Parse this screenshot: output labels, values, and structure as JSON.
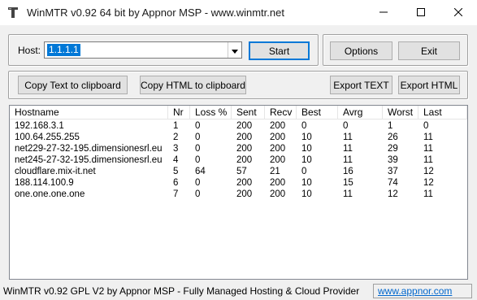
{
  "window": {
    "title": "WinMTR v0.92 64 bit by Appnor MSP - www.winmtr.net"
  },
  "host": {
    "label": "Host:",
    "value": "1.1.1.1"
  },
  "buttons": {
    "start": "Start",
    "options": "Options",
    "exit": "Exit",
    "copy_text": "Copy Text to clipboard",
    "copy_html": "Copy HTML to clipboard",
    "export_text": "Export TEXT",
    "export_html": "Export HTML"
  },
  "table": {
    "columns": [
      "Hostname",
      "Nr",
      "Loss %",
      "Sent",
      "Recv",
      "Best",
      "Avrg",
      "Worst",
      "Last"
    ],
    "rows": [
      [
        "192.168.3.1",
        "1",
        "0",
        "200",
        "200",
        "0",
        "0",
        "1",
        "0"
      ],
      [
        "100.64.255.255",
        "2",
        "0",
        "200",
        "200",
        "10",
        "11",
        "26",
        "11"
      ],
      [
        "net229-27-32-195.dimensionesrl.eu",
        "3",
        "0",
        "200",
        "200",
        "10",
        "11",
        "29",
        "11"
      ],
      [
        "net245-27-32-195.dimensionesrl.eu",
        "4",
        "0",
        "200",
        "200",
        "10",
        "11",
        "39",
        "11"
      ],
      [
        "cloudflare.mix-it.net",
        "5",
        "64",
        "57",
        "21",
        "0",
        "16",
        "37",
        "12"
      ],
      [
        "188.114.100.9",
        "6",
        "0",
        "200",
        "200",
        "10",
        "15",
        "74",
        "12"
      ],
      [
        "one.one.one.one",
        "7",
        "0",
        "200",
        "200",
        "10",
        "11",
        "12",
        "11"
      ]
    ]
  },
  "statusbar": {
    "text": "WinMTR v0.92 GPL V2 by Appnor MSP - Fully Managed Hosting & Cloud Provider",
    "link": "www.appnor.com"
  },
  "icons": {
    "app": "winmtr-app-icon",
    "minimize": "minimize-icon",
    "maximize": "maximize-icon",
    "close": "close-icon",
    "dropdown": "chevron-down-icon"
  },
  "colors": {
    "selection": "#0078d7",
    "link": "#0066cc",
    "window_bg": "#f0f0f0"
  }
}
